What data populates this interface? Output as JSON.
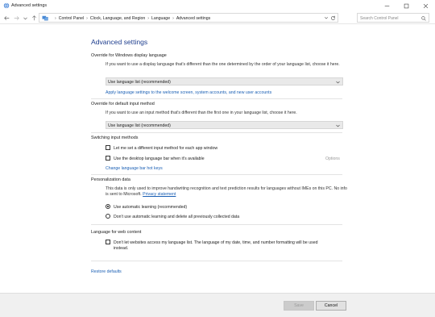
{
  "window": {
    "title": "Advanced settings",
    "app_icon": "language-globe-icon",
    "controls": [
      "minimize-icon",
      "maximize-icon",
      "close-icon"
    ]
  },
  "address": {
    "crumbs": [
      "Control Panel",
      "Clock, Language, and Region",
      "Language",
      "Advanced settings"
    ],
    "search_placeholder": "Search Control Panel"
  },
  "page": {
    "title": "Advanced settings"
  },
  "display_language": {
    "heading": "Override for Windows display language",
    "description": "If you want to use a display language that's different than the one determined by the order of your language list, choose it here.",
    "select_value": "Use language list (recommended)",
    "link": "Apply language settings to the welcome screen, system accounts, and new user accounts"
  },
  "input_method": {
    "heading": "Override for default input method",
    "description": "If you want to use an input method that's different than the first one in your language list, choose it here.",
    "select_value": "Use language list (recommended)"
  },
  "switching": {
    "heading": "Switching input methods",
    "per_app_label": "Let me set a different input method for each app window",
    "per_app_checked": false,
    "desktop_bar_label": "Use the desktop language bar when it's available",
    "desktop_bar_checked": false,
    "options_label": "Options",
    "hotkeys_link": "Change language bar hot keys"
  },
  "personalization": {
    "heading": "Personalization data",
    "description": "This data is only used to improve handwriting recognition and text prediction results for languages without IMEs on this PC. No info is sent to Microsoft.",
    "privacy_link": "Privacy statement",
    "radio_on_label": "Use automatic learning (recommended)",
    "radio_off_label": "Don't use automatic learning and delete all previously collected data",
    "selected": "Use automatic learning (recommended)"
  },
  "web_content": {
    "heading": "Language for web content",
    "checkbox_label_line1": "Don't let websites access my language list. The language of my date, time, and number formatting will be used",
    "checkbox_label_line2": "instead.",
    "checked": false
  },
  "restore_link": "Restore defaults",
  "buttons": {
    "save": "Save",
    "save_enabled": false,
    "cancel": "Cancel"
  },
  "colors": {
    "title_blue": "#1e3e8e",
    "link_blue": "#1a5fb4",
    "footer_bg": "#f0f0f0"
  }
}
